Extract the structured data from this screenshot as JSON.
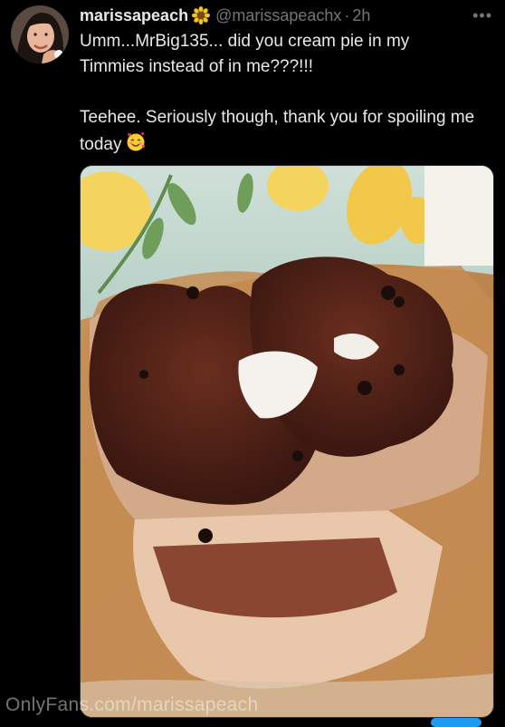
{
  "tweet": {
    "author": {
      "display_name": "marissapeach",
      "handle": "@marissapeachx",
      "name_emoji": "sunflower-icon"
    },
    "separator": "·",
    "time": "2h",
    "more_label": "•••",
    "text_line_1": "Umm...MrBig135... did you cream pie in my Timmies instead of in me???!!!",
    "text_line_2": "Teehee. Seriously though, thank you for spoiling me today",
    "text_emoji": "smiling-face-with-hearts-icon",
    "media": {
      "kind": "photo",
      "alt": "chocolate chip muffin split open with white filling"
    }
  },
  "watermark": "OnlyFans.com/marissapeach",
  "colors": {
    "background": "#000000",
    "primary_text": "#e7e9ea",
    "secondary_text": "#71767b",
    "accent": "#1d9bf0"
  }
}
